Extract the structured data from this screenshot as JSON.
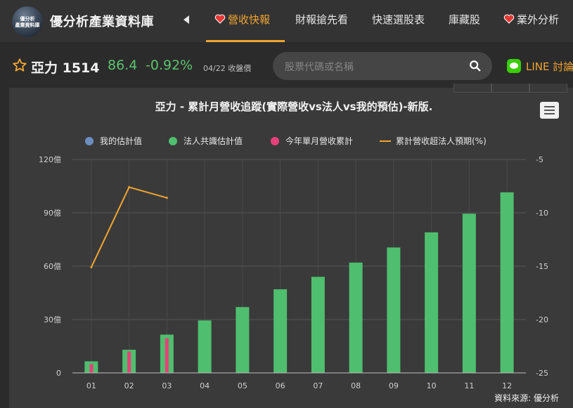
{
  "app": {
    "logo_lines": [
      "優分析",
      "產業資料庫"
    ],
    "brand": "優分析產業資料庫"
  },
  "nav": {
    "items": [
      {
        "label": "營收快報",
        "heart": true,
        "active": true
      },
      {
        "label": "財報搶先看",
        "heart": false,
        "active": false
      },
      {
        "label": "快速選股表",
        "heart": false,
        "active": false
      },
      {
        "label": "庫藏股",
        "heart": false,
        "active": false
      },
      {
        "label": "業外分析",
        "heart": true,
        "active": false
      }
    ]
  },
  "stock": {
    "name": "亞力 1514",
    "price": "86.4",
    "change": "-0.92%",
    "date": "04/22 收盤價"
  },
  "search": {
    "placeholder": "股票代碼或名稱"
  },
  "line": {
    "label": "LINE 討論"
  },
  "colors": {
    "accent": "#f0a531",
    "estimate": "#6c8ebf",
    "consensus": "#4fbe6e",
    "actual": "#e8407a",
    "price_green": "#5cc46f"
  },
  "chart_data": {
    "type": "bar",
    "title": "亞力 - 累計月營收追蹤(實際營收vs法人vs我的預估)-新版.",
    "categories": [
      "01",
      "02",
      "03",
      "04",
      "05",
      "06",
      "07",
      "08",
      "09",
      "10",
      "11",
      "12"
    ],
    "series": [
      {
        "name": "我的估計值",
        "type": "bar",
        "axis": "left",
        "values": [
          null,
          null,
          null,
          null,
          null,
          null,
          null,
          null,
          null,
          null,
          null,
          null
        ]
      },
      {
        "name": "法人共識估計值",
        "type": "bar",
        "axis": "left",
        "values": [
          6.5,
          13,
          21.5,
          29.5,
          37,
          47,
          54,
          62,
          70.5,
          79,
          89.5,
          101.5
        ]
      },
      {
        "name": "今年單月營收累計",
        "type": "bar",
        "axis": "left",
        "values": [
          5,
          12,
          19.5,
          null,
          null,
          null,
          null,
          null,
          null,
          null,
          null,
          null
        ]
      },
      {
        "name": "累計營收超法人預期(%)",
        "type": "line",
        "axis": "right",
        "values": [
          -15.1,
          -7.6,
          -8.6,
          null,
          null,
          null,
          null,
          null,
          null,
          null,
          null,
          null
        ]
      }
    ],
    "y_left": {
      "min": 0,
      "max": 120,
      "ticks": [
        0,
        30,
        60,
        90,
        120
      ],
      "tick_labels": [
        "0",
        "30億",
        "60億",
        "90億",
        "120億"
      ]
    },
    "y_right": {
      "min": -25,
      "max": -5,
      "ticks": [
        -25,
        -20,
        -15,
        -10,
        -5
      ],
      "tick_labels": [
        "-25",
        "-20",
        "-15",
        "-10",
        "-5"
      ]
    },
    "grid": true,
    "legend_position": "top",
    "source": "資料來源: 優分析"
  }
}
